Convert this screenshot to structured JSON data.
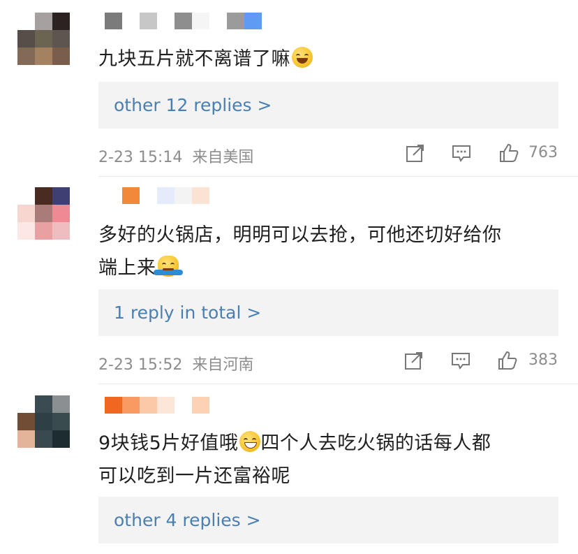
{
  "comments": [
    {
      "text": "九块五片就不离谱了嘛",
      "emoji": "laughing-tears-emoji",
      "replies_label": "other 12 replies >",
      "timestamp": "2-23 15:14",
      "location": "来自美国",
      "likes": "763",
      "avatar_colors": [
        "#ffffff",
        "#a7a0a1",
        "#2a2322",
        "#584e49",
        "#6b6453",
        "#5e5450",
        "#836a57",
        "#a48160",
        "#7b5d4b"
      ],
      "name_colors": [
        "#7b7b7b",
        "#ffffff",
        "#c7c7c7",
        "#ffffff",
        "#8e8e8e",
        "#f5f5f5",
        "#ffffff",
        "#9b9b9b",
        "#5f9bf5"
      ]
    },
    {
      "text_lines": [
        "多好的火锅店，明明可以去抢，可他还切好给你",
        "端上来"
      ],
      "emoji": "shrug-emoji",
      "replies_label": "1 reply in total >",
      "timestamp": "2-23 15:52",
      "location": "来自河南",
      "likes": "383",
      "avatar_colors": [
        "#ffffff",
        "#4a2b22",
        "#3f3f73",
        "#f7d6d0",
        "#a97c7a",
        "#ef8a95",
        "#fbe7e4",
        "#e8a0a3",
        "#efbcc0"
      ],
      "name_colors": [
        "#f08a3a",
        "#ffffff",
        "#e4ecfb",
        "#f3f3f3",
        "#fbe3d4"
      ]
    },
    {
      "text_lines": [
        "9块钱5片好值哦",
        "四个人去吃火锅的话每人都",
        "可以吃到一片还富裕呢"
      ],
      "emoji": "grinning-emoji",
      "replies_label": "other 4 replies >",
      "avatar_colors": [
        "#ffffff",
        "#3a4c52",
        "#8b8f92",
        "#704d34",
        "#2f3f46",
        "#3a4b4f",
        "#e3b49a",
        "#384a50",
        "#1d2c31"
      ],
      "name_colors": [
        "#f0681f",
        "#f89a62",
        "#fbc9a8",
        "#fbe6d8",
        "#ffffff",
        "#fcd1b4"
      ]
    }
  ]
}
